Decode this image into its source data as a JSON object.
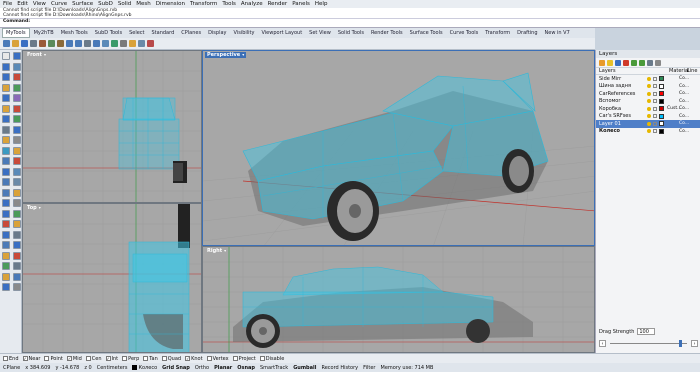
{
  "menu": [
    "File",
    "Edit",
    "View",
    "Curve",
    "Surface",
    "SubD",
    "Solid",
    "Mesh",
    "Dimension",
    "Transform",
    "Tools",
    "Analyze",
    "Render",
    "Panels",
    "Help"
  ],
  "command_history": [
    "Cannot find script file D:\\Downloads\\AlignGnps.rvb",
    "Cannot find script file D:\\Downloads\\Rhino\\AlignGnps.rvb"
  ],
  "command_prompt": "Command:",
  "toolbar_tabs": [
    "MyTools",
    "My2hTB",
    "Mesh Tools",
    "SubD Tools",
    "Select",
    "Standard",
    "CPlanes",
    "Display",
    "Visibility",
    "Viewport Layout",
    "Set View",
    "Solid Tools",
    "Render Tools",
    "Surface Tools",
    "Curve Tools",
    "Transform",
    "Drafting",
    "New in V7"
  ],
  "active_tab_index": 0,
  "viewports": {
    "front": "Front",
    "top": "Top",
    "perspective": "Perspective",
    "right": "Right"
  },
  "layers": {
    "title": "Layers",
    "col_layers": "Layers",
    "col_material": "Material",
    "col_linetype": "Line",
    "rows": [
      {
        "name": "Side Mirr",
        "color": "#2e8b57",
        "material": "",
        "linetype": "Co..."
      },
      {
        "name": "Шина задня",
        "color": "#ffffff",
        "material": "",
        "linetype": "Co..."
      },
      {
        "name": "CarReferences",
        "color": "#ff0000",
        "material": "",
        "linetype": "Co..."
      },
      {
        "name": "Вспомог",
        "color": "#000000",
        "material": "",
        "linetype": "Co..."
      },
      {
        "name": "Коробка",
        "color": "#d00000",
        "material": "Cust...",
        "linetype": "Co..."
      },
      {
        "name": "Car's SRFses",
        "color": "#00c0ff",
        "material": "",
        "linetype": "Co..."
      },
      {
        "name": "Layer 01",
        "color": "#ffffff",
        "material": "",
        "linetype": "Co...",
        "selected": true
      },
      {
        "name": "Колесо",
        "color": "#000000",
        "material": "",
        "linetype": "Co...",
        "bold": true
      }
    ]
  },
  "drag_strength": {
    "label": "Drag Strength",
    "value": "100",
    "level": 0.92
  },
  "osnaps": [
    {
      "label": "End",
      "checked": false
    },
    {
      "label": "Near",
      "checked": true
    },
    {
      "label": "Point",
      "checked": false
    },
    {
      "label": "Mid",
      "checked": true
    },
    {
      "label": "Cen",
      "checked": false
    },
    {
      "label": "Int",
      "checked": true
    },
    {
      "label": "Perp",
      "checked": false
    },
    {
      "label": "Tan",
      "checked": false
    },
    {
      "label": "Quad",
      "checked": false
    },
    {
      "label": "Knot",
      "checked": true
    },
    {
      "label": "Vertex",
      "checked": false
    },
    {
      "label": "Project",
      "checked": false
    },
    {
      "label": "Disable",
      "checked": false
    }
  ],
  "status": {
    "cplane": "CPlane",
    "x": "x 384.609",
    "y": "y -14.678",
    "z": "z 0",
    "units": "Centimeters",
    "layer": "Колесо",
    "grid_snap": "Grid Snap",
    "ortho": "Ortho",
    "planar": "Planar",
    "osnap": "Osnap",
    "smarttrack": "SmartTrack",
    "gumball": "Gumball",
    "record_history": "Record History",
    "filter": "Filter",
    "memory": "Memory use: 714 MB"
  },
  "colors": {
    "accent": "#3b6fb6",
    "wire": "#3fc7e6",
    "viewport_bg": "#a7a7a7"
  }
}
